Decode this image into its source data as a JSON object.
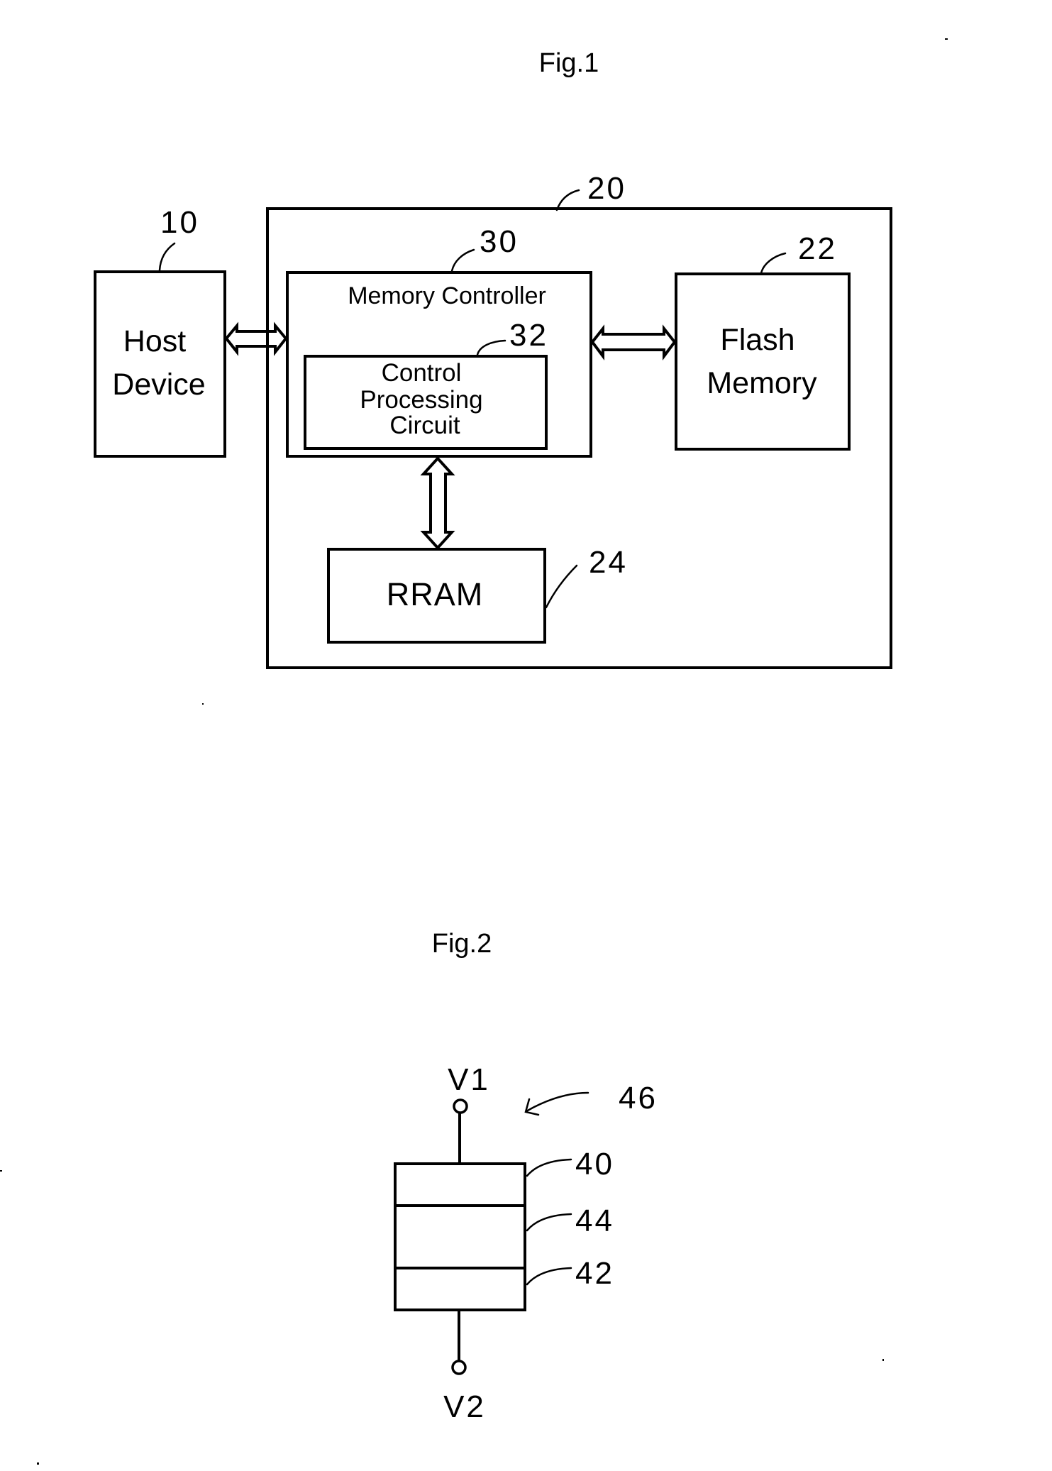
{
  "figure1": {
    "title": "Fig.1",
    "host": {
      "ref": "10",
      "lines": [
        "Host",
        "Device"
      ]
    },
    "device": {
      "ref": "20"
    },
    "memory_controller": {
      "ref": "30",
      "label": "Memory Controller"
    },
    "control_processing_circuit": {
      "ref": "32",
      "lines": [
        "Control",
        "Processing",
        "Circuit"
      ]
    },
    "flash": {
      "ref": "22",
      "lines": [
        "Flash",
        "Memory"
      ]
    },
    "rram": {
      "ref": "24",
      "label": "RRAM"
    },
    "connections": [
      {
        "from": "Host Device",
        "to": "Memory Controller",
        "type": "bidirectional"
      },
      {
        "from": "Memory Controller",
        "to": "Flash Memory",
        "type": "bidirectional"
      },
      {
        "from": "Memory Controller",
        "to": "RRAM",
        "type": "bidirectional"
      }
    ]
  },
  "figure2": {
    "title": "Fig.2",
    "element_ref": "46",
    "top_terminal": "V1",
    "bottom_terminal": "V2",
    "layers": [
      {
        "ref": "40",
        "position": "top"
      },
      {
        "ref": "44",
        "position": "middle"
      },
      {
        "ref": "42",
        "position": "bottom"
      }
    ]
  }
}
